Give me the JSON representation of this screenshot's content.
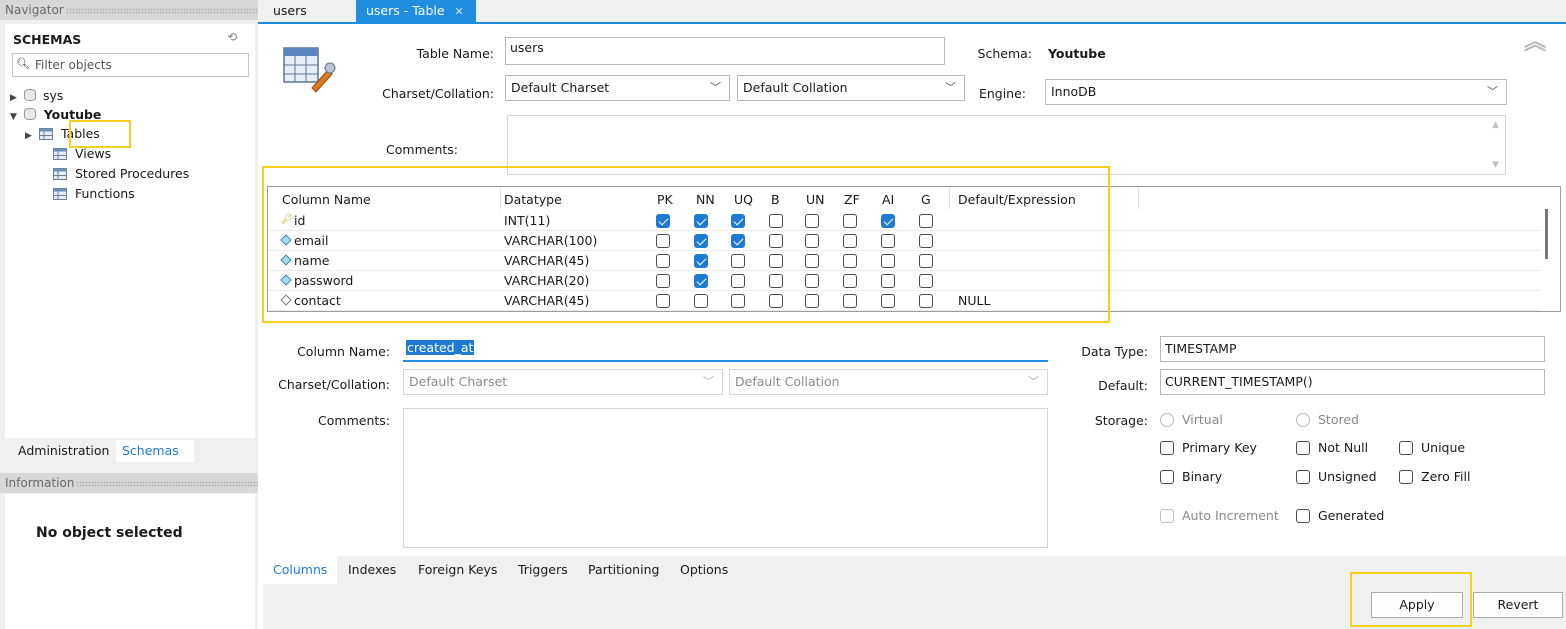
{
  "navigator": {
    "title": "Navigator",
    "schemas_label": "SCHEMAS",
    "filter_placeholder": "Filter objects",
    "tree": {
      "sys": "sys",
      "youtube": "Youtube",
      "tables": "Tables",
      "views": "Views",
      "stored_procedures": "Stored Procedures",
      "functions": "Functions"
    },
    "tab_administration": "Administration",
    "tab_schemas": "Schemas",
    "information_title": "Information",
    "no_object": "No object selected"
  },
  "tabs": [
    {
      "label": "users"
    },
    {
      "label": "users - Table"
    }
  ],
  "table": {
    "name_label": "Table Name:",
    "name_value": "users",
    "schema_label": "Schema:",
    "schema_value": "Youtube",
    "charset_label": "Charset/Collation:",
    "charset_value": "Default Charset",
    "collation_value": "Default Collation",
    "engine_label": "Engine:",
    "engine_value": "InnoDB",
    "comments_label": "Comments:"
  },
  "grid": {
    "headers": [
      "Column Name",
      "Datatype",
      "PK",
      "NN",
      "UQ",
      "B",
      "UN",
      "ZF",
      "AI",
      "G",
      "Default/Expression"
    ],
    "rows": [
      {
        "name": "id",
        "type": "INT(11)",
        "flags": [
          true,
          true,
          true,
          false,
          false,
          false,
          true,
          false
        ],
        "default": "",
        "icon": "key"
      },
      {
        "name": "email",
        "type": "VARCHAR(100)",
        "flags": [
          false,
          true,
          true,
          false,
          false,
          false,
          false,
          false
        ],
        "default": "",
        "icon": "diamond"
      },
      {
        "name": "name",
        "type": "VARCHAR(45)",
        "flags": [
          false,
          true,
          false,
          false,
          false,
          false,
          false,
          false
        ],
        "default": "",
        "icon": "diamond"
      },
      {
        "name": "password",
        "type": "VARCHAR(20)",
        "flags": [
          false,
          true,
          false,
          false,
          false,
          false,
          false,
          false
        ],
        "default": "",
        "icon": "diamond"
      },
      {
        "name": "contact",
        "type": "VARCHAR(45)",
        "flags": [
          false,
          false,
          false,
          false,
          false,
          false,
          false,
          false
        ],
        "default": "NULL",
        "icon": "diamond-empty"
      }
    ]
  },
  "column": {
    "name_label": "Column Name:",
    "name_value": "created_at",
    "charset_label": "Charset/Collation:",
    "charset_value": "Default Charset",
    "collation_value": "Default Collation",
    "comments_label": "Comments:",
    "datatype_label": "Data Type:",
    "datatype_value": "TIMESTAMP",
    "default_label": "Default:",
    "default_value": "CURRENT_TIMESTAMP()",
    "storage_label": "Storage:",
    "virtual": "Virtual",
    "stored": "Stored",
    "primary_key": "Primary Key",
    "not_null": "Not Null",
    "unique": "Unique",
    "binary": "Binary",
    "unsigned": "Unsigned",
    "zero_fill": "Zero Fill",
    "auto_increment": "Auto Increment",
    "generated": "Generated"
  },
  "subtabs": [
    "Columns",
    "Indexes",
    "Foreign Keys",
    "Triggers",
    "Partitioning",
    "Options"
  ],
  "buttons": {
    "apply": "Apply",
    "revert": "Revert"
  },
  "colors": {
    "accent": "#1f8ee0",
    "highlight": "#f2d21e",
    "check": "#1f7ad4"
  }
}
